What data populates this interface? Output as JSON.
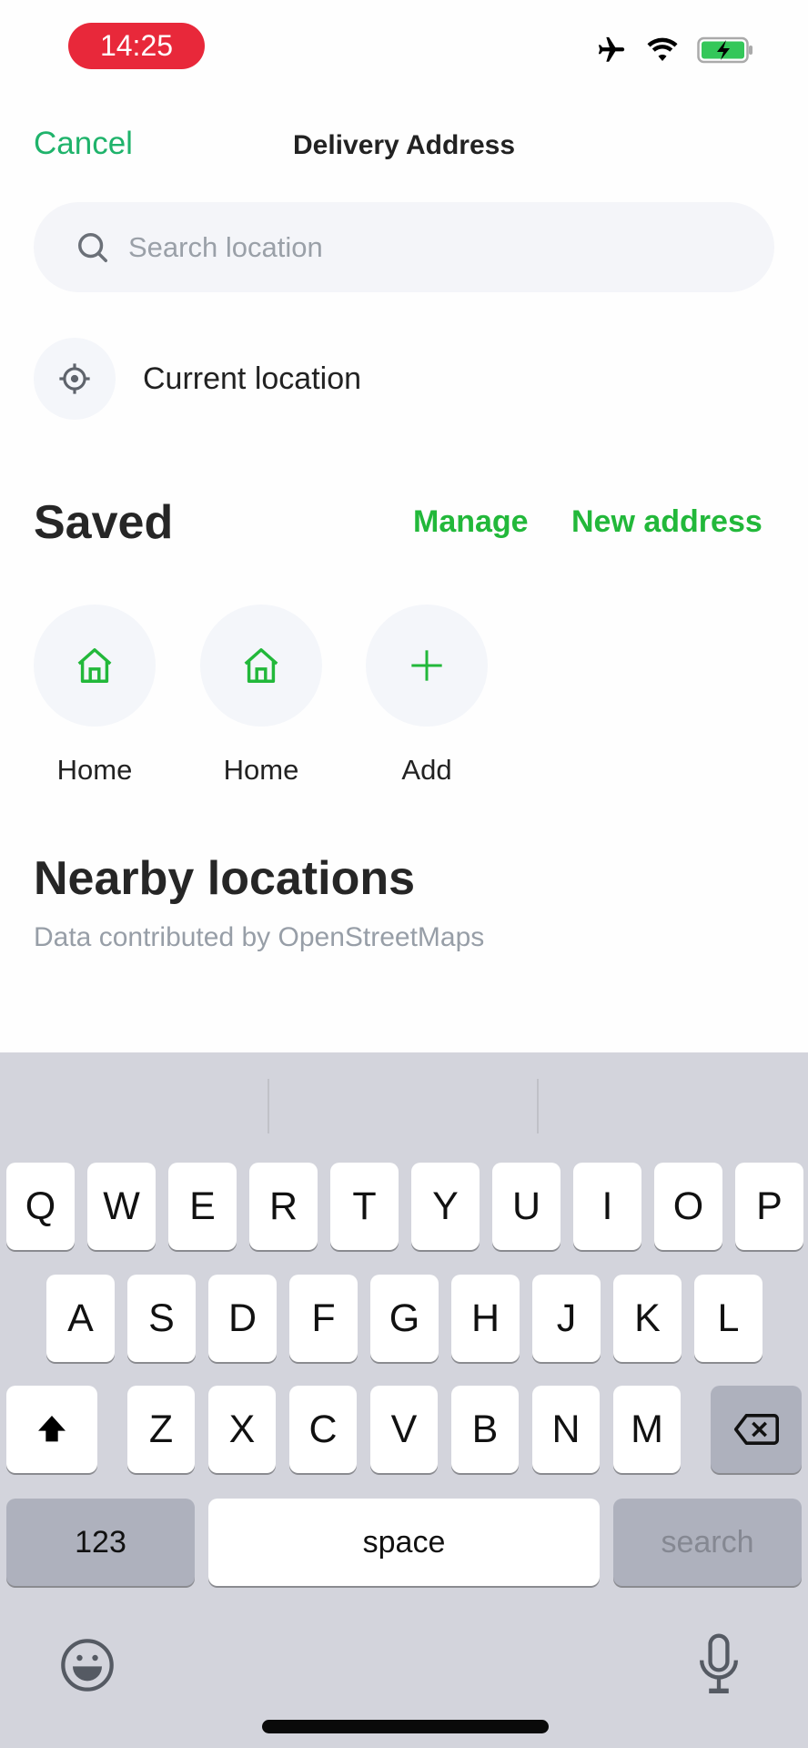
{
  "status_bar": {
    "time": "14:25",
    "icons": [
      "airplane-icon",
      "wifi-icon",
      "battery-charging-icon"
    ]
  },
  "header": {
    "cancel_label": "Cancel",
    "title": "Delivery Address"
  },
  "search": {
    "placeholder": "Search location",
    "value": ""
  },
  "current_location": {
    "label": "Current location",
    "icon": "crosshair-icon"
  },
  "saved": {
    "title": "Saved",
    "manage_label": "Manage",
    "new_address_label": "New address",
    "items": [
      {
        "label": "Home",
        "icon": "home-icon"
      },
      {
        "label": "Home",
        "icon": "home-icon"
      },
      {
        "label": "Add",
        "icon": "plus-icon"
      }
    ]
  },
  "nearby": {
    "title": "Nearby locations",
    "attribution": "Data contributed by OpenStreetMaps"
  },
  "colors": {
    "accent_green": "#22b83a",
    "cancel_green": "#1fb36b",
    "time_pill": "#e8283a"
  },
  "keyboard": {
    "row1": [
      "Q",
      "W",
      "E",
      "R",
      "T",
      "Y",
      "U",
      "I",
      "O",
      "P"
    ],
    "row2": [
      "A",
      "S",
      "D",
      "F",
      "G",
      "H",
      "J",
      "K",
      "L"
    ],
    "row3": [
      "Z",
      "X",
      "C",
      "V",
      "B",
      "N",
      "M"
    ],
    "numbers_label": "123",
    "space_label": "space",
    "return_label": "search"
  }
}
